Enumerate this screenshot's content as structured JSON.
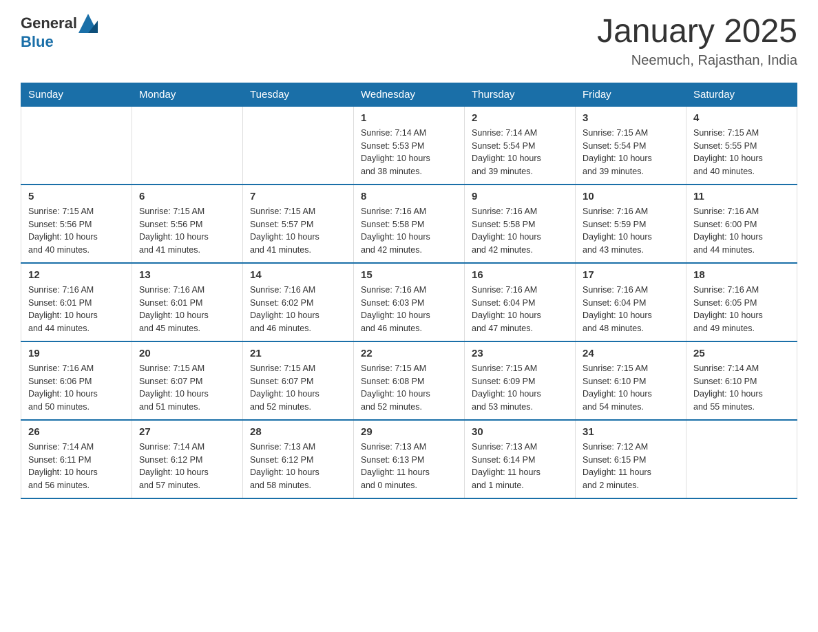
{
  "header": {
    "logo_general": "General",
    "logo_blue": "Blue",
    "month_title": "January 2025",
    "location": "Neemuch, Rajasthan, India"
  },
  "days_of_week": [
    "Sunday",
    "Monday",
    "Tuesday",
    "Wednesday",
    "Thursday",
    "Friday",
    "Saturday"
  ],
  "weeks": [
    [
      {
        "day": "",
        "info": ""
      },
      {
        "day": "",
        "info": ""
      },
      {
        "day": "",
        "info": ""
      },
      {
        "day": "1",
        "info": "Sunrise: 7:14 AM\nSunset: 5:53 PM\nDaylight: 10 hours\nand 38 minutes."
      },
      {
        "day": "2",
        "info": "Sunrise: 7:14 AM\nSunset: 5:54 PM\nDaylight: 10 hours\nand 39 minutes."
      },
      {
        "day": "3",
        "info": "Sunrise: 7:15 AM\nSunset: 5:54 PM\nDaylight: 10 hours\nand 39 minutes."
      },
      {
        "day": "4",
        "info": "Sunrise: 7:15 AM\nSunset: 5:55 PM\nDaylight: 10 hours\nand 40 minutes."
      }
    ],
    [
      {
        "day": "5",
        "info": "Sunrise: 7:15 AM\nSunset: 5:56 PM\nDaylight: 10 hours\nand 40 minutes."
      },
      {
        "day": "6",
        "info": "Sunrise: 7:15 AM\nSunset: 5:56 PM\nDaylight: 10 hours\nand 41 minutes."
      },
      {
        "day": "7",
        "info": "Sunrise: 7:15 AM\nSunset: 5:57 PM\nDaylight: 10 hours\nand 41 minutes."
      },
      {
        "day": "8",
        "info": "Sunrise: 7:16 AM\nSunset: 5:58 PM\nDaylight: 10 hours\nand 42 minutes."
      },
      {
        "day": "9",
        "info": "Sunrise: 7:16 AM\nSunset: 5:58 PM\nDaylight: 10 hours\nand 42 minutes."
      },
      {
        "day": "10",
        "info": "Sunrise: 7:16 AM\nSunset: 5:59 PM\nDaylight: 10 hours\nand 43 minutes."
      },
      {
        "day": "11",
        "info": "Sunrise: 7:16 AM\nSunset: 6:00 PM\nDaylight: 10 hours\nand 44 minutes."
      }
    ],
    [
      {
        "day": "12",
        "info": "Sunrise: 7:16 AM\nSunset: 6:01 PM\nDaylight: 10 hours\nand 44 minutes."
      },
      {
        "day": "13",
        "info": "Sunrise: 7:16 AM\nSunset: 6:01 PM\nDaylight: 10 hours\nand 45 minutes."
      },
      {
        "day": "14",
        "info": "Sunrise: 7:16 AM\nSunset: 6:02 PM\nDaylight: 10 hours\nand 46 minutes."
      },
      {
        "day": "15",
        "info": "Sunrise: 7:16 AM\nSunset: 6:03 PM\nDaylight: 10 hours\nand 46 minutes."
      },
      {
        "day": "16",
        "info": "Sunrise: 7:16 AM\nSunset: 6:04 PM\nDaylight: 10 hours\nand 47 minutes."
      },
      {
        "day": "17",
        "info": "Sunrise: 7:16 AM\nSunset: 6:04 PM\nDaylight: 10 hours\nand 48 minutes."
      },
      {
        "day": "18",
        "info": "Sunrise: 7:16 AM\nSunset: 6:05 PM\nDaylight: 10 hours\nand 49 minutes."
      }
    ],
    [
      {
        "day": "19",
        "info": "Sunrise: 7:16 AM\nSunset: 6:06 PM\nDaylight: 10 hours\nand 50 minutes."
      },
      {
        "day": "20",
        "info": "Sunrise: 7:15 AM\nSunset: 6:07 PM\nDaylight: 10 hours\nand 51 minutes."
      },
      {
        "day": "21",
        "info": "Sunrise: 7:15 AM\nSunset: 6:07 PM\nDaylight: 10 hours\nand 52 minutes."
      },
      {
        "day": "22",
        "info": "Sunrise: 7:15 AM\nSunset: 6:08 PM\nDaylight: 10 hours\nand 52 minutes."
      },
      {
        "day": "23",
        "info": "Sunrise: 7:15 AM\nSunset: 6:09 PM\nDaylight: 10 hours\nand 53 minutes."
      },
      {
        "day": "24",
        "info": "Sunrise: 7:15 AM\nSunset: 6:10 PM\nDaylight: 10 hours\nand 54 minutes."
      },
      {
        "day": "25",
        "info": "Sunrise: 7:14 AM\nSunset: 6:10 PM\nDaylight: 10 hours\nand 55 minutes."
      }
    ],
    [
      {
        "day": "26",
        "info": "Sunrise: 7:14 AM\nSunset: 6:11 PM\nDaylight: 10 hours\nand 56 minutes."
      },
      {
        "day": "27",
        "info": "Sunrise: 7:14 AM\nSunset: 6:12 PM\nDaylight: 10 hours\nand 57 minutes."
      },
      {
        "day": "28",
        "info": "Sunrise: 7:13 AM\nSunset: 6:12 PM\nDaylight: 10 hours\nand 58 minutes."
      },
      {
        "day": "29",
        "info": "Sunrise: 7:13 AM\nSunset: 6:13 PM\nDaylight: 11 hours\nand 0 minutes."
      },
      {
        "day": "30",
        "info": "Sunrise: 7:13 AM\nSunset: 6:14 PM\nDaylight: 11 hours\nand 1 minute."
      },
      {
        "day": "31",
        "info": "Sunrise: 7:12 AM\nSunset: 6:15 PM\nDaylight: 11 hours\nand 2 minutes."
      },
      {
        "day": "",
        "info": ""
      }
    ]
  ]
}
